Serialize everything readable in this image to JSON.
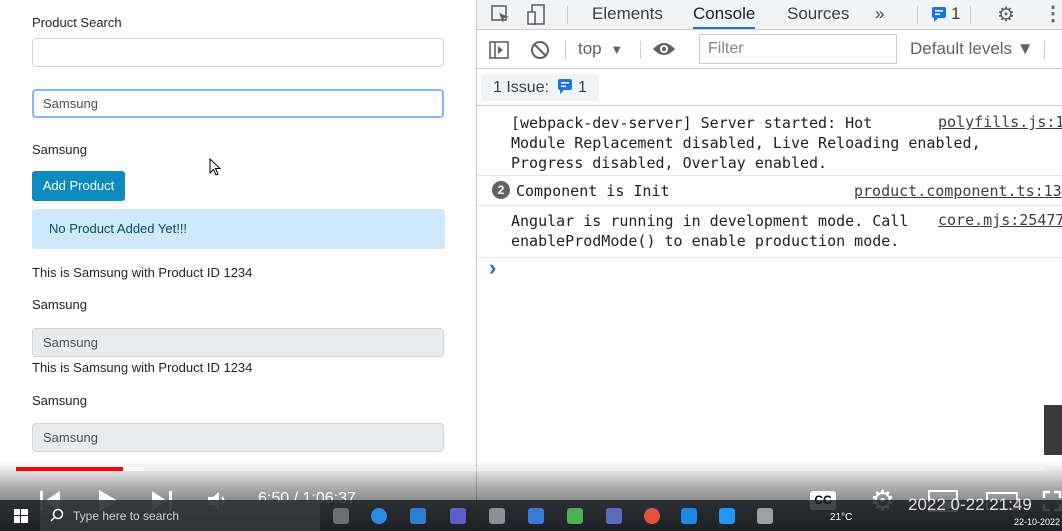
{
  "app": {
    "product_search_label": "Product Search",
    "search_input_value": "",
    "focused_input_value": "Samsung",
    "bound_text": "Samsung",
    "add_button": "Add Product",
    "alert_text": "No Product Added Yet!!!",
    "product_line_1": "This is Samsung with Product ID 1234",
    "name_label_1": "Samsung",
    "readonly_value_1": "Samsung",
    "product_line_2": "This is Samsung with Product ID 1234",
    "name_label_2": "Samsung",
    "readonly_value_2": "Samsung"
  },
  "devtools": {
    "tabs": [
      "Elements",
      "Console",
      "Sources"
    ],
    "active_tab": "Console",
    "more_tabs": "»",
    "issues_badge_count": "1",
    "context": "top",
    "filter_placeholder": "Filter",
    "levels": "Default levels ▼",
    "issue_button_label": "1 Issue:",
    "issue_count": "1",
    "messages": [
      {
        "lines": [
          "[webpack-dev-server] Server started: Hot",
          "Module Replacement disabled, Live Reloading enabled,",
          "Progress disabled, Overlay enabled."
        ],
        "source": "polyfills.js:1",
        "repeat": ""
      },
      {
        "lines": [
          "Component is Init"
        ],
        "source": "product.component.ts:13",
        "repeat": "2"
      },
      {
        "lines": [
          "Angular is running in development mode. Call",
          "enableProdMode() to enable production mode."
        ],
        "source": "core.mjs:25477",
        "repeat": ""
      }
    ],
    "prompt": "›"
  },
  "player": {
    "time": "6:50 / 1:06:37",
    "progress_fraction": 0.104,
    "buffered_fraction": 0.124,
    "cc_label": "CC"
  },
  "taskbar": {
    "search_placeholder": "Type here to search",
    "weather": "21°C",
    "clock_time": "2022 0-22 21:49",
    "date": "22-10-2022"
  },
  "colors": {
    "primary": "#0d8bbf",
    "alert_bg": "#cfe8fc",
    "devtools_accent": "#1a73e8",
    "progress": "#ff0000"
  }
}
